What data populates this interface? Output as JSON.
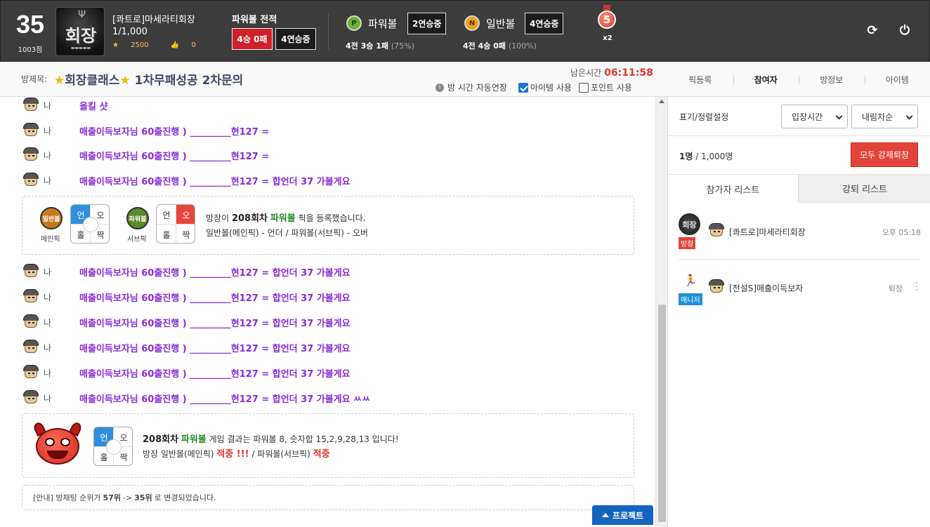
{
  "header": {
    "level": "35",
    "points": "1003점",
    "badge_text": "회장",
    "username": "[콰트로]마세라티회장",
    "count": "1/1,000",
    "stars": "2500",
    "likes": "0",
    "record_title": "파워볼 전적",
    "record_result": "4승 0패",
    "record_streak": "4연승중",
    "powerball": {
      "coin": "P",
      "label": "파워볼",
      "streak": "2연승중",
      "record": "4전 3승 1패",
      "pct": "(75%)"
    },
    "normalball": {
      "coin": "N",
      "label": "일반볼",
      "streak": "4연승중",
      "record": "4전 4승 0패",
      "pct": "(100%)"
    },
    "medal_number": "5",
    "medal_multiplier": "x2"
  },
  "room": {
    "label": "방제목:",
    "title_star": "★",
    "title": "회장클래스",
    "title_rest": "1차무패성공 2차문의",
    "remaining_label": "남은시간",
    "remaining_time": "06:11:58",
    "auto_extend": "방 시간 자동연장",
    "item_use": "아이템 사용",
    "point_use": "포인트 사용",
    "tabs": [
      "픽등록",
      "참여자",
      "방정보",
      "아이템"
    ]
  },
  "chat": {
    "who": "나",
    "messages": [
      "올킬 샷",
      "매출이득보자님 60출진행 ) _________현127 =",
      "매출이득보자님 60출진행 ) _________현127 =",
      "매출이득보자님 60출진행 ) _________현127 = 합언더 37 가볼게요",
      "매출이득보자님 60출진행 ) _________현127 = 합언더 37 가볼게요",
      "매출이득보자님 60출진행 ) _________현127 = 합언더 37 가볼게요",
      "매출이득보자님 60출진행 ) _________현127 = 합언더 37 가볼게요",
      "매출이득보자님 60출진행 ) _________현127 = 합언더 37 가볼게요",
      "매출이득보자님 60출진행 ) _________현127 = 합언더 37 가볼게요",
      "매출이득보자님 60출진행 ) _________현127 = 합언더 37 가볼게요 ㅆㅆ"
    ],
    "pick_card": {
      "main_icon": "일반볼",
      "main_label": "메인픽",
      "sub_icon": "파워볼",
      "sub_label": "서브픽",
      "grid_cells": [
        "언",
        "오",
        "홀",
        "짝"
      ],
      "line1_pre": "방장이",
      "line1_round": "208회차",
      "line1_game": "파워볼",
      "line1_post": "픽을 등록했습니다.",
      "line2": "일반볼(메인픽) - 언더 / 파워볼(서브픽) - 오버"
    },
    "result_card": {
      "round": "208회차",
      "game": "파워볼",
      "line1_post": "게임 결과는 파워볼 8, 숫자합 15,2,9,28,13 입니다!",
      "line2_pre": "방장 일반볼(메인픽)",
      "hit1": "적중 !!!",
      "line2_mid": "/ 파워볼(서브픽)",
      "hit2": "적중"
    },
    "notice": {
      "pre": "[안내] 방채팅 순위가",
      "from": "57위",
      "arrow": "->",
      "to": "35위",
      "post": "로 변경되었습니다."
    },
    "project_button": "프로젝트"
  },
  "panel": {
    "sort_label": "표기/정렬설정",
    "sort_by": "입장시간",
    "sort_order": "내림차순",
    "count": "1명",
    "count_total": "/ 1,000명",
    "kick_all": "모두 강제퇴장",
    "tab_participants": "참가자 리스트",
    "tab_kicked": "강퇴 리스트",
    "members": [
      {
        "role": "방장",
        "badge": "회장",
        "name": "[콰트로]마세라티회장",
        "meta": "오후 05:18"
      },
      {
        "role": "매니저",
        "name": "[전설S]매출이득보자",
        "meta": "퇴장"
      }
    ]
  },
  "colors": {
    "accent_red": "#e0342f",
    "chat_purple": "#8a2bd8",
    "blue": "#1565c0"
  }
}
